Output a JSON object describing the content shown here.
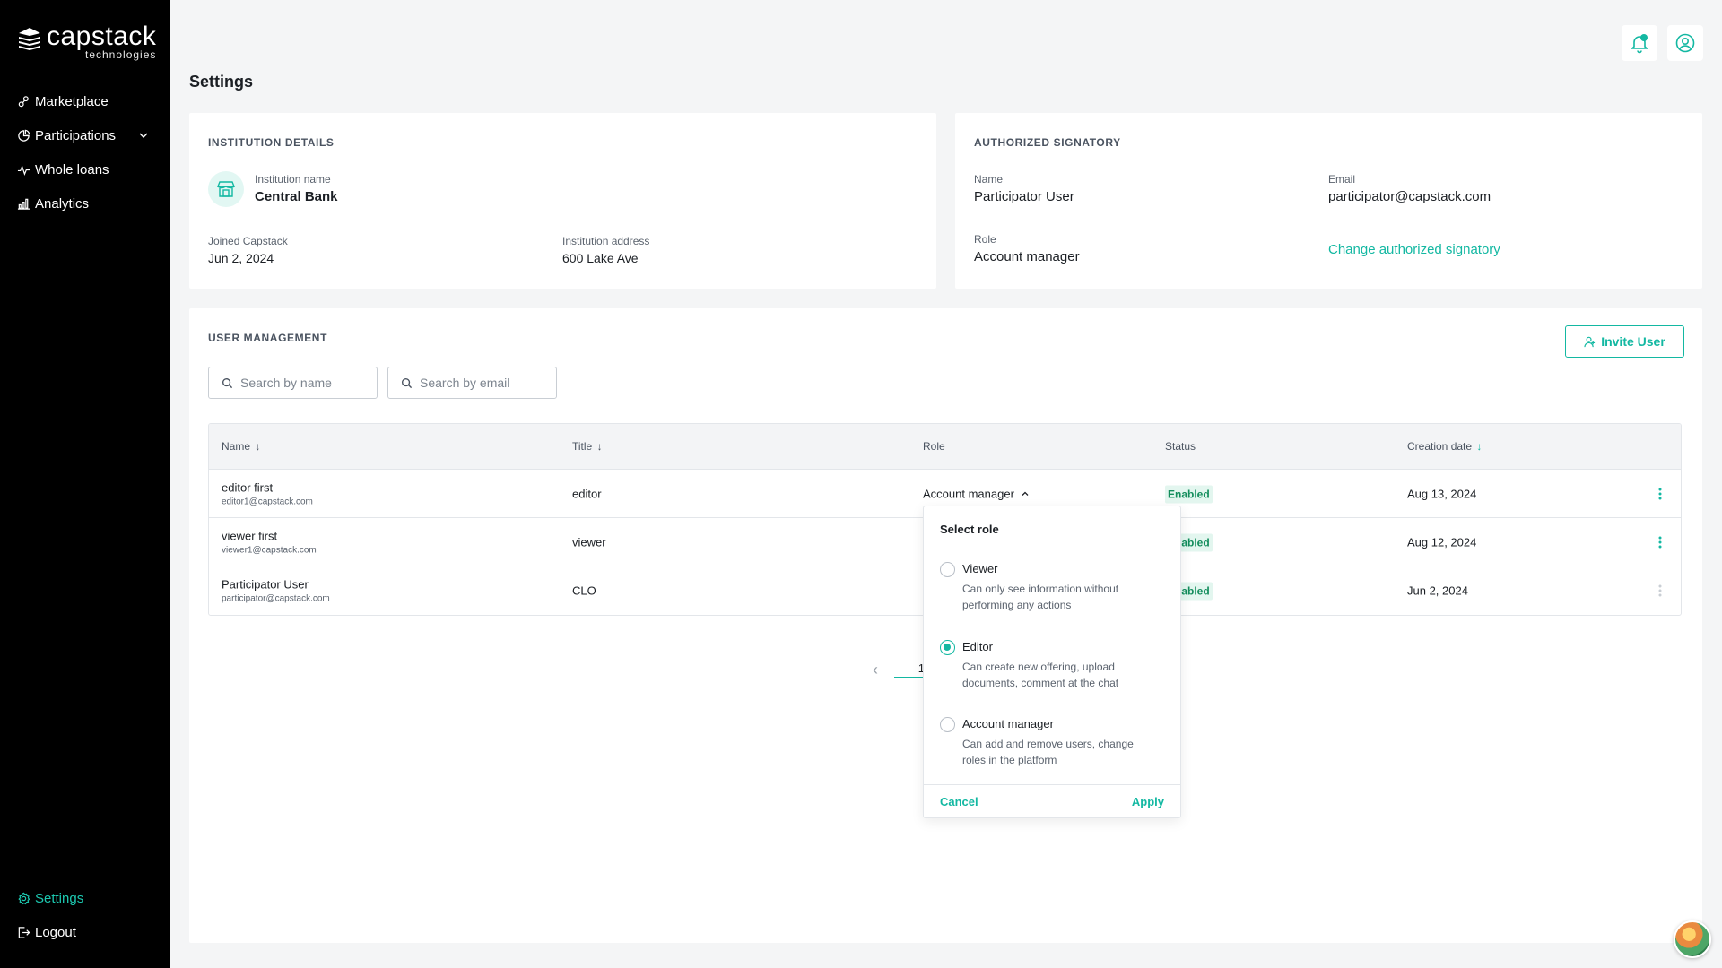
{
  "brand": {
    "name": "capstack",
    "sub": "technologies"
  },
  "sidebar": {
    "items": [
      {
        "label": "Marketplace"
      },
      {
        "label": "Participations"
      },
      {
        "label": "Whole loans"
      },
      {
        "label": "Analytics"
      }
    ],
    "bottom": [
      {
        "label": "Settings"
      },
      {
        "label": "Logout"
      }
    ]
  },
  "page": {
    "title": "Settings"
  },
  "institution": {
    "section_title": "INSTITUTION DETAILS",
    "name_label": "Institution name",
    "name_value": "Central Bank",
    "joined_label": "Joined Capstack",
    "joined_value": "Jun 2, 2024",
    "address_label": "Institution address",
    "address_value": "600 Lake Ave"
  },
  "signatory": {
    "section_title": "AUTHORIZED SIGNATORY",
    "name_label": "Name",
    "name_value": "Participator User",
    "email_label": "Email",
    "email_value": "participator@capstack.com",
    "role_label": "Role",
    "role_value": "Account manager",
    "change_link": "Change authorized signatory"
  },
  "users": {
    "section_title": "USER MANAGEMENT",
    "invite_label": "Invite User",
    "search_name_placeholder": "Search by name",
    "search_email_placeholder": "Search by email",
    "columns": {
      "name": "Name",
      "title": "Title",
      "role": "Role",
      "status": "Status",
      "created": "Creation date"
    },
    "sort_arrow": "↓",
    "rows": [
      {
        "name": "editor first",
        "email": "editor1@capstack.com",
        "title": "editor",
        "role": "Account manager",
        "status": "Enabled",
        "created": "Aug 13, 2024"
      },
      {
        "name": "viewer first",
        "email": "viewer1@capstack.com",
        "title": "viewer",
        "status": "Enabled",
        "created": "Aug 12, 2024"
      },
      {
        "name": "Participator User",
        "email": "participator@capstack.com",
        "title": "CLO",
        "status": "Enabled",
        "created": "Jun 2, 2024"
      }
    ],
    "pager": {
      "prev": "‹",
      "page": "1"
    }
  },
  "role_dropdown": {
    "title": "Select role",
    "options": [
      {
        "label": "Viewer",
        "desc": "Can only see information without performing any actions",
        "checked": false
      },
      {
        "label": "Editor",
        "desc": "Can create new offering, upload documents, comment at the chat",
        "checked": true
      },
      {
        "label": "Account manager",
        "desc": "Can add and remove users, change roles in the platform",
        "checked": false
      }
    ],
    "cancel": "Cancel",
    "apply": "Apply"
  },
  "colors": {
    "accent": "#13b8a2",
    "sidebar": "#000000",
    "badge_bg": "#e3f6ef",
    "badge_text": "#138d5c"
  }
}
